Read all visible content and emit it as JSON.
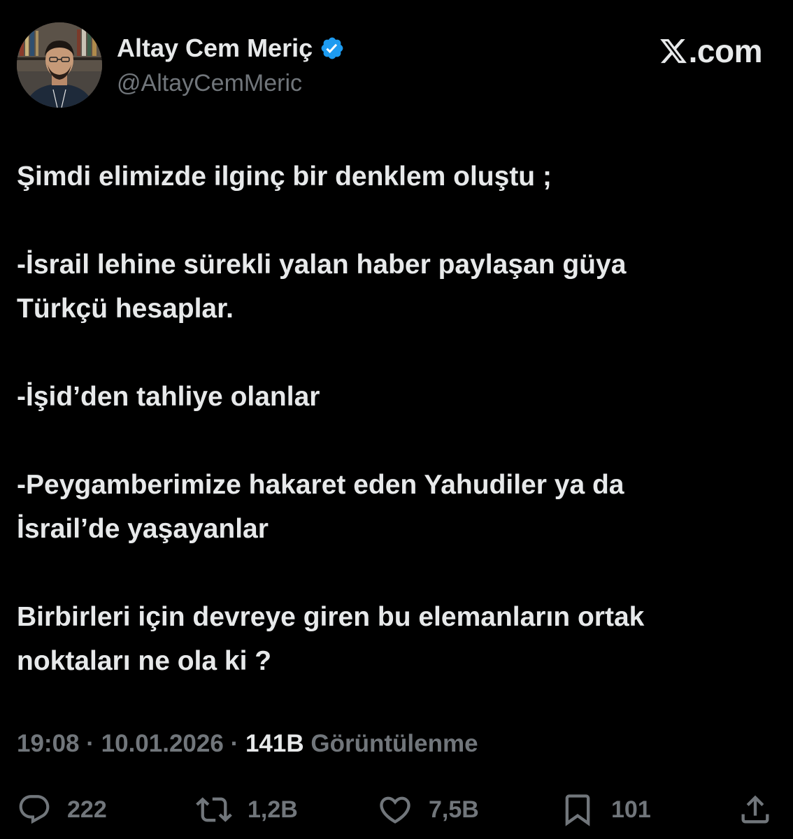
{
  "author": {
    "display_name": "Altay Cem Meriç",
    "handle": "@AltayCemMeric",
    "verified": true,
    "avatar_icon": "profile-photo"
  },
  "brand": {
    "logo_icon": "x-logo-icon",
    "text": ".com"
  },
  "tweet": {
    "paragraphs": [
      [
        "Şimdi elimizde ilginç bir denklem oluştu ;"
      ],
      [
        "-İsrail lehine sürekli yalan haber paylaşan güya",
        "Türkçü hesaplar."
      ],
      [
        "-İşid’den tahliye olanlar"
      ],
      [
        "-Peygamberimize hakaret eden Yahudiler ya da",
        "İsrail’de yaşayanlar"
      ],
      [
        "Birbirleri için devreye giren bu elemanların ortak",
        "noktaları ne ola ki ?"
      ]
    ]
  },
  "meta": {
    "time": "19:08",
    "separator": "·",
    "date": "10.01.2026",
    "views_count": "141B",
    "views_label": "Görüntülenme"
  },
  "actions": {
    "reply_count": "222",
    "retweet_count": "1,2B",
    "like_count": "7,5B",
    "bookmark_count": "101"
  },
  "colors": {
    "background": "#000000",
    "text": "#e7e9ea",
    "muted": "#71767b",
    "verified": "#1d9bf0"
  }
}
